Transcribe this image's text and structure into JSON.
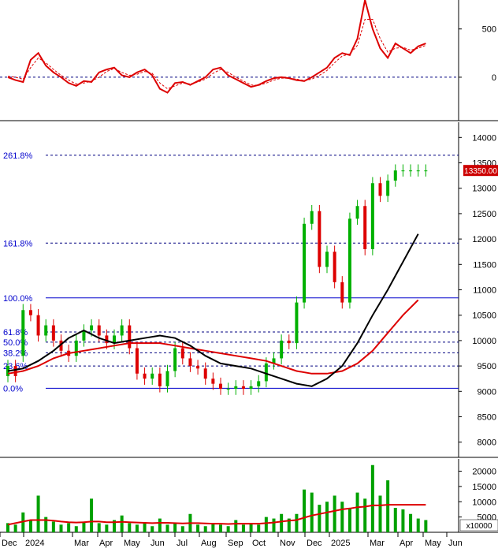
{
  "chart_data": [
    {
      "panel": "oscillator",
      "type": "line",
      "ylim": [
        -450,
        800
      ],
      "y_ticks": [
        "500",
        "0"
      ],
      "y_tick_values": [
        500,
        0
      ],
      "zero_line": 0,
      "colors": {
        "osc": "#dd0000",
        "signal": "#dd0000",
        "zero": "#000080"
      },
      "x": [
        0,
        10,
        20,
        30,
        40,
        50,
        60,
        70,
        80,
        90,
        100,
        110,
        120,
        130,
        140,
        150,
        160,
        170,
        180,
        190,
        200,
        210,
        220,
        230,
        240,
        250,
        260,
        270,
        280,
        290,
        300,
        310,
        320,
        330,
        340,
        350,
        360,
        370,
        380,
        390,
        400,
        410,
        420,
        430,
        440,
        450,
        460,
        470,
        480,
        490,
        500,
        510,
        520,
        530,
        540,
        550
      ],
      "series": [
        {
          "key": "osc",
          "values": [
            0,
            -30,
            -50,
            180,
            250,
            120,
            50,
            0,
            -60,
            -90,
            -40,
            -50,
            50,
            80,
            100,
            20,
            0,
            50,
            80,
            20,
            -120,
            -160,
            -60,
            -50,
            -80,
            -40,
            0,
            80,
            100,
            20,
            -20,
            -60,
            -100,
            -80,
            -40,
            -10,
            0,
            -10,
            -30,
            -40,
            0,
            50,
            100,
            200,
            250,
            230,
            400,
            800,
            500,
            300,
            200,
            350,
            300,
            250,
            320,
            350
          ]
        },
        {
          "key": "signal",
          "values": [
            10,
            0,
            -20,
            100,
            200,
            150,
            80,
            20,
            -30,
            -70,
            -60,
            -40,
            0,
            60,
            90,
            50,
            20,
            30,
            60,
            40,
            -60,
            -120,
            -90,
            -60,
            -70,
            -50,
            -20,
            40,
            80,
            50,
            0,
            -40,
            -80,
            -85,
            -60,
            -30,
            -10,
            -10,
            -20,
            -35,
            -20,
            20,
            70,
            150,
            220,
            240,
            330,
            600,
            600,
            400,
            260,
            300,
            310,
            280,
            300,
            330
          ]
        }
      ]
    },
    {
      "panel": "price",
      "type": "candlestick",
      "ylim": [
        7700,
        14300
      ],
      "y_ticks": [
        "14000",
        "13500",
        "13000",
        "12500",
        "12000",
        "11500",
        "11000",
        "10500",
        "10000",
        "9500",
        "9000",
        "8500",
        "8000"
      ],
      "y_tick_values": [
        14000,
        13500,
        13000,
        12500,
        12000,
        11500,
        11000,
        10500,
        10000,
        9500,
        9000,
        8500,
        8000
      ],
      "current_price_label": "13350.00",
      "current_price": 13350,
      "fibonacci": [
        {
          "label": "261.8%",
          "value": 13650
        },
        {
          "label": "161.8%",
          "value": 11920
        },
        {
          "label": "100.0%",
          "value": 10840
        },
        {
          "label": "61.8%",
          "value": 10170
        },
        {
          "label": "50.0%",
          "value": 9970
        },
        {
          "label": "38.2%",
          "value": 9760
        },
        {
          "label": "23.6%",
          "value": 9500
        },
        {
          "label": "0.0%",
          "value": 9060
        }
      ],
      "colors": {
        "up": "#00b000",
        "down": "#dd0000",
        "ma_fast": "#000000",
        "ma_slow": "#dd0000",
        "fib_major": "#0000cc",
        "fib_minor": "#000080",
        "price_box": "#cc0000"
      },
      "moving_averages": {
        "x": [
          0,
          20,
          40,
          60,
          80,
          100,
          120,
          140,
          160,
          180,
          200,
          220,
          240,
          260,
          280,
          300,
          320,
          340,
          360,
          380,
          400,
          420,
          440,
          460,
          480,
          500,
          520,
          540
        ],
        "fast": [
          9400,
          9450,
          9600,
          9800,
          10050,
          10200,
          10050,
          9950,
          10000,
          10050,
          10100,
          10050,
          9900,
          9700,
          9550,
          9500,
          9450,
          9350,
          9250,
          9150,
          9100,
          9250,
          9500,
          9950,
          10500,
          11000,
          11550,
          12100
        ],
        "slow": [
          9350,
          9400,
          9500,
          9650,
          9750,
          9800,
          9850,
          9900,
          9950,
          9950,
          9950,
          9900,
          9850,
          9800,
          9750,
          9700,
          9650,
          9600,
          9500,
          9400,
          9350,
          9350,
          9400,
          9550,
          9800,
          10150,
          10500,
          10800
        ]
      },
      "candles_x": [
        0,
        10,
        20,
        30,
        40,
        50,
        60,
        70,
        80,
        90,
        100,
        110,
        120,
        130,
        140,
        150,
        160,
        170,
        180,
        190,
        200,
        210,
        220,
        230,
        240,
        250,
        260,
        270,
        280,
        290,
        300,
        310,
        320,
        330,
        340,
        350,
        360,
        370,
        380,
        390,
        400,
        410,
        420,
        430,
        440,
        450,
        460,
        470,
        480,
        490,
        500,
        510,
        520,
        530,
        540,
        550
      ],
      "candles_close": [
        9500,
        9300,
        10600,
        10500,
        10100,
        10300,
        10000,
        9800,
        9700,
        10000,
        10200,
        10300,
        10100,
        9950,
        10100,
        10300,
        9850,
        9350,
        9250,
        9350,
        9100,
        9400,
        9850,
        9650,
        9500,
        9450,
        9250,
        9150,
        9050,
        9050,
        9100,
        9050,
        9100,
        9200,
        9550,
        9650,
        10000,
        9950,
        10750,
        12300,
        12550,
        11450,
        11750,
        11150,
        10750,
        12400,
        12650,
        11800,
        13100,
        12850,
        13150,
        13350,
        13350,
        13350,
        13350,
        13350
      ],
      "candles_x_note": "",
      "candles_open": [
        9300,
        9500,
        9700,
        10600,
        10500,
        10100,
        10300,
        10000,
        9800,
        9700,
        10000,
        10200,
        10300,
        10100,
        9950,
        10100,
        10300,
        9850,
        9350,
        9250,
        9350,
        9100,
        9400,
        9850,
        9650,
        9500,
        9450,
        9250,
        9150,
        9050,
        9050,
        9100,
        9050,
        9100,
        9200,
        9550,
        9650,
        10000,
        9950,
        10750,
        12300,
        12550,
        11450,
        11750,
        11150,
        10750,
        12400,
        12650,
        11800,
        13100,
        12850,
        13150,
        13350,
        13350,
        13350,
        13350
      ]
    },
    {
      "panel": "volume",
      "type": "bar",
      "ylim": [
        0,
        24000
      ],
      "y_ticks": [
        "20000",
        "15000",
        "10000",
        "5000"
      ],
      "y_tick_values": [
        20000,
        15000,
        10000,
        5000
      ],
      "unit_label": "x10000",
      "colors": {
        "bar": "#00a000",
        "ma": "#dd0000"
      },
      "x": [
        0,
        10,
        20,
        30,
        40,
        50,
        60,
        70,
        80,
        90,
        100,
        110,
        120,
        130,
        140,
        150,
        160,
        170,
        180,
        190,
        200,
        210,
        220,
        230,
        240,
        250,
        260,
        270,
        280,
        290,
        300,
        310,
        320,
        330,
        340,
        350,
        360,
        370,
        380,
        390,
        400,
        410,
        420,
        430,
        440,
        450,
        460,
        470,
        480,
        490,
        500,
        510,
        520,
        530,
        540,
        550
      ],
      "values": [
        3000,
        2500,
        6500,
        4000,
        12000,
        5000,
        3500,
        2500,
        3000,
        2000,
        3500,
        11000,
        3000,
        2500,
        4000,
        5500,
        3000,
        2500,
        3000,
        2000,
        4500,
        2500,
        3000,
        2000,
        6000,
        2500,
        2000,
        3000,
        2500,
        2000,
        4000,
        2500,
        3000,
        2500,
        5000,
        4500,
        6000,
        4500,
        6000,
        14000,
        13000,
        9000,
        10000,
        12000,
        10000,
        8000,
        13000,
        11000,
        22000,
        12000,
        17000,
        8000,
        7500,
        6000,
        4500,
        4000
      ],
      "ma_values": [
        2500,
        3000,
        3500,
        4000,
        4000,
        4000,
        3800,
        3500,
        3300,
        3200,
        3300,
        3500,
        3500,
        3300,
        3300,
        3400,
        3300,
        3200,
        3100,
        3000,
        3100,
        3100,
        3000,
        2900,
        3000,
        3000,
        2900,
        2800,
        2800,
        2700,
        2800,
        2800,
        2800,
        2800,
        3000,
        3200,
        3500,
        3800,
        4000,
        4800,
        5500,
        6000,
        6500,
        7000,
        7500,
        7800,
        8200,
        8400,
        8800,
        8800,
        9000,
        9000,
        9000,
        9000,
        9000,
        9000
      ]
    }
  ],
  "x_axis": {
    "labels": [
      "Dec",
      "2024",
      "Mar",
      "Apr",
      "May",
      "Jun",
      "Jul",
      "Aug",
      "Sep",
      "Oct",
      "Nov",
      "Dec",
      "2025",
      "Mar",
      "Apr",
      "May",
      "Jun"
    ],
    "label_pos": [
      0,
      30,
      92,
      124,
      155,
      189,
      222,
      253,
      287,
      318,
      353,
      387,
      418,
      467,
      505,
      537,
      567
    ]
  }
}
